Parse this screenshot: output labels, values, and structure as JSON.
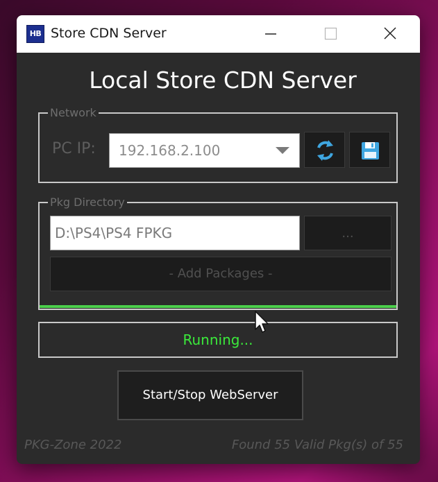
{
  "window": {
    "title": "Store CDN Server",
    "app_icon_text": "HB"
  },
  "main": {
    "heading": "Local Store CDN Server"
  },
  "network": {
    "legend": "Network",
    "pc_ip_label": "PC IP:",
    "pc_ip_value": "192.168.2.100",
    "refresh_icon": "refresh-icon",
    "save_icon": "floppy-disk-icon"
  },
  "pkg_directory": {
    "legend": "Pkg Directory",
    "path_value": "D:\\PS4\\PS4 FPKG",
    "browse_label": "...",
    "add_packages_label": "- Add Packages -",
    "progress_fraction": 1.0
  },
  "status": {
    "text": "Running...",
    "color": "#3bea3b"
  },
  "actions": {
    "start_stop_label": "Start/Stop WebServer"
  },
  "footer": {
    "left_text": "PKG-Zone 2022",
    "right_text": "Found 55 Valid Pkg(s) of 55"
  },
  "colors": {
    "window_bg": "#2b2b2b",
    "progress_green": "#4cd04c",
    "icon_blue": "#3fa6e0"
  }
}
